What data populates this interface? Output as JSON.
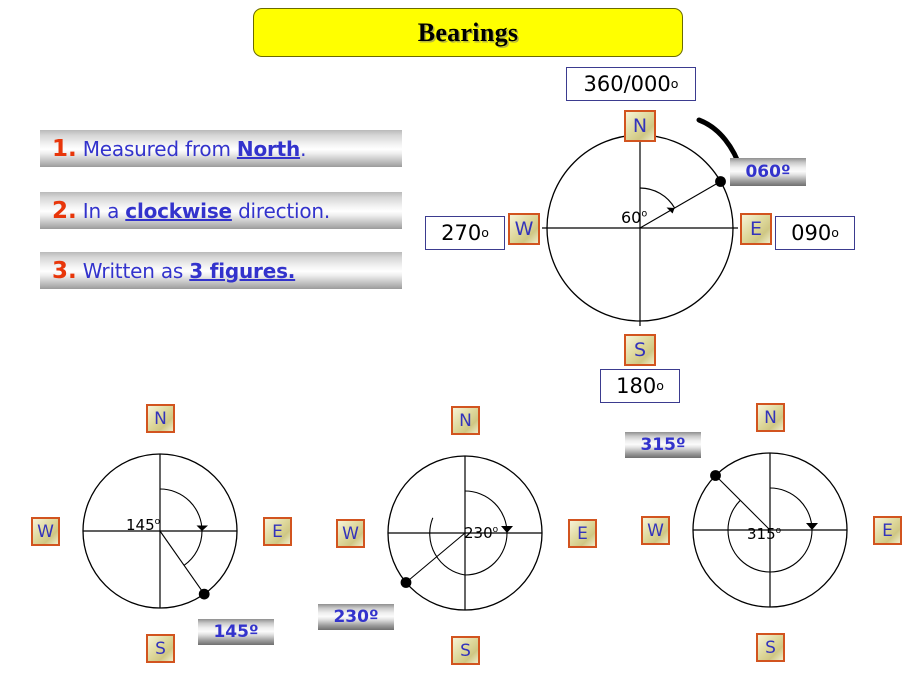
{
  "title": {
    "text": "Bearings"
  },
  "rules": [
    {
      "num": "1.",
      "pre": "Measured from ",
      "kw": "North",
      "post": "."
    },
    {
      "num": "2.",
      "pre": "In a ",
      "kw": "clockwise",
      "post": " direction."
    },
    {
      "num": "3.",
      "pre": "Written as ",
      "kw": "3 figures.",
      "post": ""
    }
  ],
  "main_compass": {
    "north_label": "N",
    "east_label": "E",
    "south_label": "S",
    "west_label": "W",
    "north_value": "360/000",
    "east_value": "090",
    "south_value": "180",
    "west_value": "270",
    "degree_symbol": "o",
    "angle_label": "60",
    "answer_badge": "060º",
    "bearing_degrees": 60
  },
  "examples": [
    {
      "name": "example-145",
      "north_label": "N",
      "east_label": "E",
      "south_label": "S",
      "west_label": "W",
      "angle_label": "145",
      "degree_symbol": "o",
      "answer_badge": "145º",
      "bearing_degrees": 145
    },
    {
      "name": "example-230",
      "north_label": "N",
      "east_label": "E",
      "south_label": "S",
      "west_label": "W",
      "angle_label": "230",
      "degree_symbol": "o",
      "answer_badge": "230º",
      "bearing_degrees": 230
    },
    {
      "name": "example-315",
      "north_label": "N",
      "east_label": "E",
      "south_label": "S",
      "west_label": "W",
      "angle_label": "315",
      "degree_symbol": "o",
      "answer_badge": "315º",
      "bearing_degrees": 315
    }
  ],
  "colors": {
    "title_bg": "#ffff00",
    "rule_number": "#e8360a",
    "rule_text": "#3333cc",
    "badge_text": "#3333cc",
    "cardinal_border": "#d2541f",
    "cardinal_text": "#3333bb",
    "box_border": "#3b3b8f"
  }
}
